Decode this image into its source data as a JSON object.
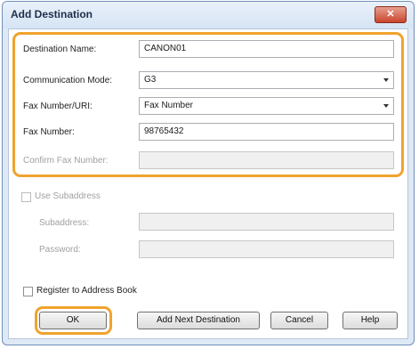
{
  "window": {
    "title": "Add Destination",
    "close_glyph": "✕"
  },
  "form": {
    "destination_name": {
      "label": "Destination Name:",
      "value": "CANON01"
    },
    "communication_mode": {
      "label": "Communication Mode:",
      "value": "G3"
    },
    "fax_number_uri": {
      "label": "Fax Number/URI:",
      "value": "Fax Number"
    },
    "fax_number": {
      "label": "Fax Number:",
      "value": "98765432"
    },
    "confirm_fax_number": {
      "label": "Confirm Fax Number:",
      "value": ""
    }
  },
  "subaddress": {
    "use_label": "Use Subaddress",
    "subaddress_label": "Subaddress:",
    "password_label": "Password:"
  },
  "register": {
    "label": "Register to Address Book"
  },
  "buttons": {
    "ok": "OK",
    "add_next": "Add Next Destination",
    "cancel": "Cancel",
    "help": "Help"
  },
  "colors": {
    "highlight": "#f0a32d",
    "frame": "#dfe9f5"
  }
}
